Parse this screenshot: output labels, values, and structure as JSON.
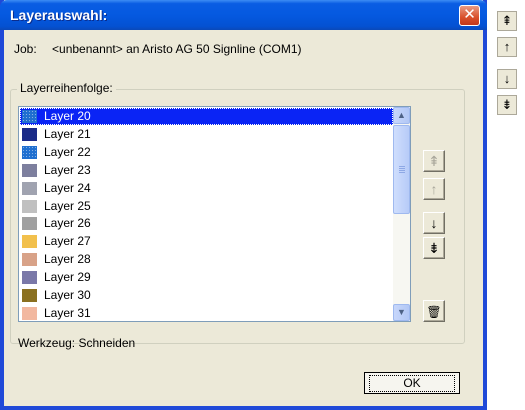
{
  "window": {
    "title": "Layerauswahl:",
    "close_glyph": "✕"
  },
  "job": {
    "label": "Job:",
    "value": "<unbenannt> an Aristo AG 50 Signline (COM1)"
  },
  "group": {
    "label": "Layerreihenfolge:"
  },
  "layers": [
    {
      "label": "Layer 20",
      "color": "#1f6fd0",
      "selected": true
    },
    {
      "label": "Layer 21",
      "color": "#1a2a88",
      "selected": false
    },
    {
      "label": "Layer 22",
      "color": "#1f6fd0",
      "selected": false
    },
    {
      "label": "Layer 23",
      "color": "#7d7f9e",
      "selected": false
    },
    {
      "label": "Layer 24",
      "color": "#a0a3b0",
      "selected": false
    },
    {
      "label": "Layer 25",
      "color": "#c0c0c0",
      "selected": false
    },
    {
      "label": "Layer 26",
      "color": "#a0a0a0",
      "selected": false
    },
    {
      "label": "Layer 27",
      "color": "#f2c04c",
      "selected": false
    },
    {
      "label": "Layer 28",
      "color": "#d8a288",
      "selected": false
    },
    {
      "label": "Layer 29",
      "color": "#7a78a8",
      "selected": false
    },
    {
      "label": "Layer 30",
      "color": "#8a7020",
      "selected": false
    },
    {
      "label": "Layer 31",
      "color": "#f2b8a0",
      "selected": false
    }
  ],
  "tools": {
    "move_top": "⇞",
    "move_up": "↑",
    "move_down": "↓",
    "move_bottom": "⇟",
    "delete": "🗑"
  },
  "status": {
    "werkzeug": "Werkzeug: Schneiden"
  },
  "buttons": {
    "ok": "OK"
  },
  "external_toolbar": [
    "⇞",
    "↑",
    "↓",
    "⇟"
  ]
}
